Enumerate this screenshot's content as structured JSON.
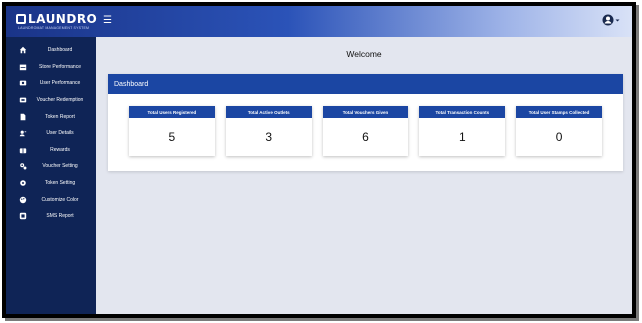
{
  "brand": {
    "name": "LAUNDRO",
    "subtitle": "LAUNDROMAT MANAGEMENT SYSTEM"
  },
  "header": {
    "menu_icon": "hamburger-icon",
    "user_icon": "user-account-icon"
  },
  "sidebar": {
    "items": [
      {
        "label": "Dashboard",
        "icon": "home-icon"
      },
      {
        "label": "Store Performance",
        "icon": "store-icon"
      },
      {
        "label": "User Performance",
        "icon": "users-icon"
      },
      {
        "label": "Voucher Redemption",
        "icon": "ticket-icon"
      },
      {
        "label": "Token Report",
        "icon": "file-icon"
      },
      {
        "label": "User Details",
        "icon": "user-card-icon"
      },
      {
        "label": "Rewards",
        "icon": "gift-icon"
      },
      {
        "label": "Voucher Setting",
        "icon": "gears-icon"
      },
      {
        "label": "Token Setting",
        "icon": "gear-icon"
      },
      {
        "label": "Customize Color",
        "icon": "palette-icon"
      },
      {
        "label": "SMS Report",
        "icon": "sms-icon"
      }
    ]
  },
  "main": {
    "welcome": "Welcome",
    "dashboard_title": "Dashboard",
    "stats": [
      {
        "title": "Total Users Registered",
        "value": "5"
      },
      {
        "title": "Total Active Outlets",
        "value": "3"
      },
      {
        "title": "Total Vouchers Given",
        "value": "6"
      },
      {
        "title": "Total Transaction Counts",
        "value": "1"
      },
      {
        "title": "Total User Stamps Collected",
        "value": "0"
      }
    ]
  },
  "colors": {
    "topbar": "#1a3488",
    "sidebar": "#0f2456",
    "accent": "#1b46a3",
    "background": "#e3e6ef"
  }
}
